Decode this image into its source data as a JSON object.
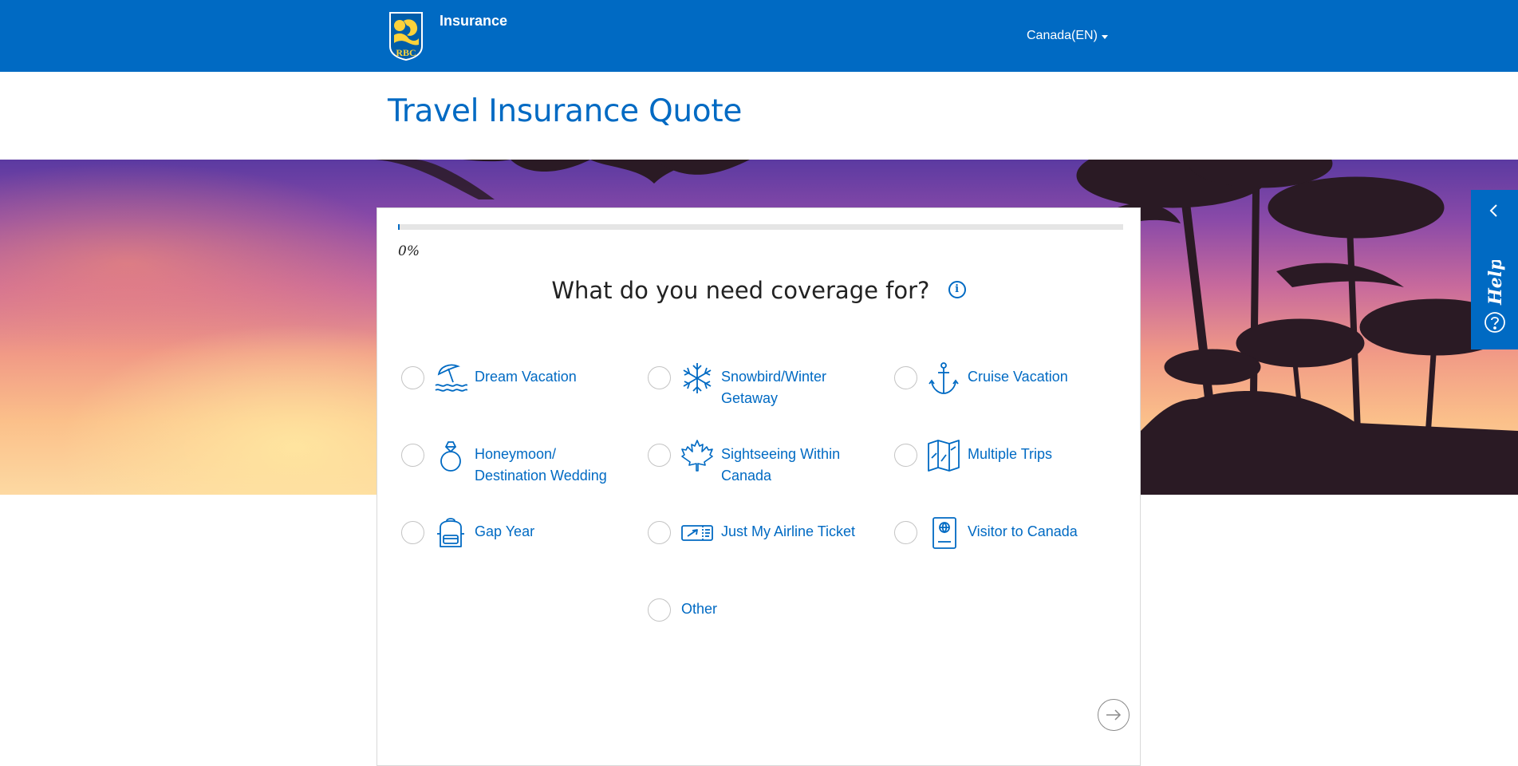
{
  "header": {
    "logo_text": "RBC",
    "brand_label": "Insurance",
    "region": "Canada(EN)"
  },
  "page": {
    "title": "Travel Insurance Quote"
  },
  "progress": {
    "value": 0,
    "label": "0%"
  },
  "question": {
    "text": "What do you need coverage for?",
    "info_icon": "info-icon"
  },
  "options": [
    {
      "label": "Dream Vacation",
      "icon": "beach-umbrella-icon",
      "selected": false
    },
    {
      "label": "Snowbird/Winter Getaway",
      "icon": "snowflake-icon",
      "selected": false
    },
    {
      "label": "Cruise Vacation",
      "icon": "anchor-icon",
      "selected": false
    },
    {
      "label": "Honeymoon/ Destination Wedding",
      "icon": "ring-icon",
      "selected": false
    },
    {
      "label": "Sightseeing Within Canada",
      "icon": "maple-leaf-icon",
      "selected": false
    },
    {
      "label": "Multiple Trips",
      "icon": "map-icon",
      "selected": false
    },
    {
      "label": "Gap Year",
      "icon": "backpack-icon",
      "selected": false
    },
    {
      "label": "Just My Airline Ticket",
      "icon": "airline-ticket-icon",
      "selected": false
    },
    {
      "label": "Visitor to Canada",
      "icon": "passport-icon",
      "selected": false
    },
    {
      "label": "Other",
      "icon": "",
      "selected": false
    }
  ],
  "next_button": {
    "icon": "arrow-right-icon"
  },
  "help_tab": {
    "label": "Help",
    "icon": "question-circle-icon",
    "collapse_icon": "chevron-left-icon"
  },
  "colors": {
    "brand": "#006ac3",
    "text": "#222222",
    "accent_gold": "#fdd23a"
  }
}
